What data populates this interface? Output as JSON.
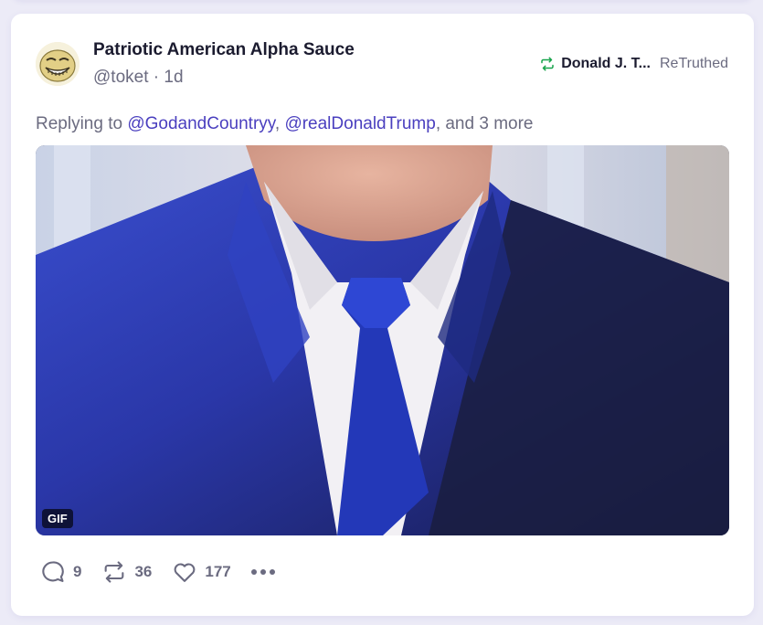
{
  "post": {
    "display_name": "Patriotic American Alpha Sauce",
    "handle": "@toket",
    "separator": " · ",
    "time": "1d",
    "retruth": {
      "icon": "retruth-icon",
      "name": "Donald J. T...",
      "label": "ReTruthed"
    },
    "replying": {
      "prefix": "Replying to ",
      "mention1": "@GodandCountryy",
      "comma": ", ",
      "mention2": "@realDonaldTrump",
      "suffix": ", and 3 more"
    },
    "media": {
      "badge": "GIF"
    },
    "actions": {
      "reply_count": "9",
      "retruth_count": "36",
      "like_count": "177"
    }
  },
  "colors": {
    "accent": "#4a3fbf",
    "retruth_green": "#16a34a",
    "muted": "#6b6b80"
  }
}
